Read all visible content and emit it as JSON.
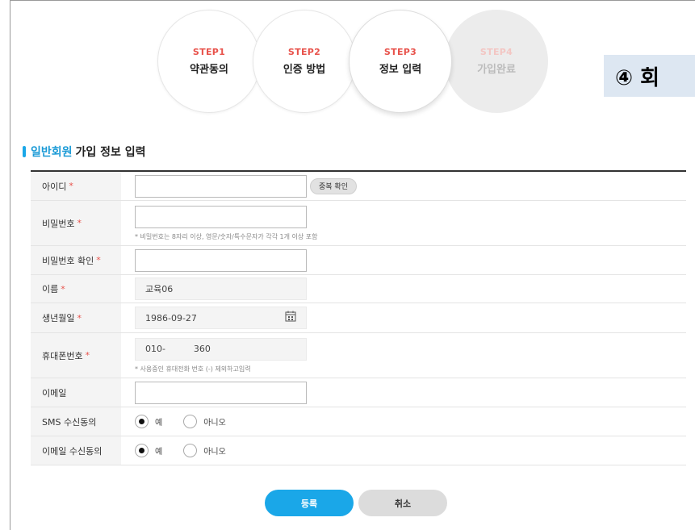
{
  "steps": [
    {
      "num": "STEP1",
      "label": "약관동의"
    },
    {
      "num": "STEP2",
      "label": "인증 방법"
    },
    {
      "num": "STEP3",
      "label": "정보 입력"
    },
    {
      "num": "STEP4",
      "label": "가입완료"
    }
  ],
  "badge": "④ 회",
  "section": {
    "highlight": "일반회원",
    "rest": "가입 정보 입력"
  },
  "required_mark": "*",
  "fields": {
    "id": {
      "label": "아이디",
      "value": "",
      "dup_button": "중복 확인"
    },
    "password": {
      "label": "비밀번호",
      "value": "",
      "hint": "* 비밀번호는 8자리 이상, 영문/숫자/특수문자가 각각 1개 이상 포함"
    },
    "password_confirm": {
      "label": "비밀번호 확인",
      "value": ""
    },
    "name": {
      "label": "이름",
      "value": "교육06"
    },
    "birth": {
      "label": "생년월일",
      "value": "1986-09-27",
      "icon": "calendar-icon"
    },
    "phone": {
      "label": "휴대폰번호",
      "value": "010-          360",
      "hint": "* 사용중인 휴대전화 번호 (-) 제외하고입력"
    },
    "email": {
      "label": "이메일",
      "value": ""
    },
    "sms": {
      "label": "SMS 수신동의",
      "yes": "예",
      "no": "아니오",
      "selected": "yes"
    },
    "email_consent": {
      "label": "이메일 수신동의",
      "yes": "예",
      "no": "아니오",
      "selected": "yes"
    }
  },
  "actions": {
    "submit": "등록",
    "cancel": "취소"
  },
  "colors": {
    "accent": "#1aa7e8",
    "step_number": "#e8524b",
    "required": "#e8524b"
  }
}
